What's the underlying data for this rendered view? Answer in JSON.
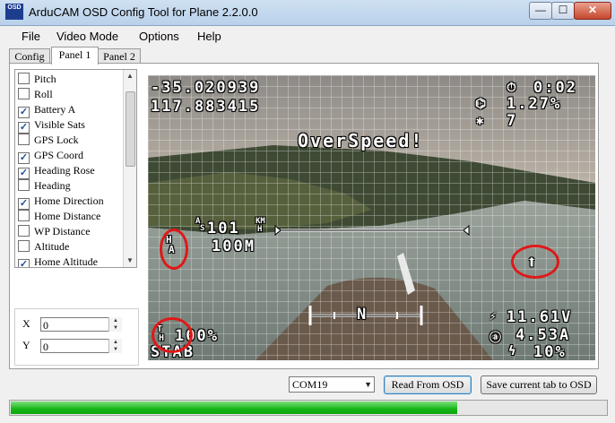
{
  "window": {
    "title": "ArduCAM OSD Config Tool for Plane 2.2.0.0",
    "icon_text": "ArduCAM OSD",
    "controls": [
      "minimize-icon",
      "maximize-icon",
      "close-icon"
    ]
  },
  "menu": [
    "File",
    "Video Mode",
    "Options",
    "Help"
  ],
  "tabs": [
    {
      "label": "Config",
      "active": false
    },
    {
      "label": "Panel 1",
      "active": true
    },
    {
      "label": "Panel 2",
      "active": false
    }
  ],
  "panel_items": [
    {
      "label": "Pitch",
      "checked": false
    },
    {
      "label": "Roll",
      "checked": false
    },
    {
      "label": "Battery A",
      "checked": true
    },
    {
      "label": "Visible Sats",
      "checked": true
    },
    {
      "label": "GPS Lock",
      "checked": false
    },
    {
      "label": "GPS Coord",
      "checked": true
    },
    {
      "label": "Heading Rose",
      "checked": true
    },
    {
      "label": "Heading",
      "checked": false
    },
    {
      "label": "Home Direction",
      "checked": true
    },
    {
      "label": "Home Distance",
      "checked": false
    },
    {
      "label": "WP Distance",
      "checked": false
    },
    {
      "label": "Altitude",
      "checked": false
    },
    {
      "label": "Home Altitude",
      "checked": true
    }
  ],
  "position": {
    "x_label": "X",
    "x_value": "0",
    "y_label": "Y",
    "y_value": "0"
  },
  "osd": {
    "lat": "-35.020939",
    "lon": "117.883415",
    "flight_time": "0:02",
    "throttle_pct": "1.27%",
    "sats": "7",
    "warning": "OverSpeed!",
    "airspeed": "101",
    "speed_unit_1": "KM",
    "speed_unit_2": "H",
    "home_alt": "100M",
    "throttle": "100%",
    "mode": "STAB",
    "heading_rose": "N",
    "voltage": "11.61V",
    "current": "4.53A",
    "battery_pct": "10%",
    "ha_label_top": "H",
    "ha_label_bottom": "A",
    "as_label_top": "A",
    "as_label_bottom": "S",
    "th_label_top": "T",
    "th_label_bottom": "H"
  },
  "bottom": {
    "com_port": "COM19",
    "read_button": "Read From OSD",
    "save_button": "Save current tab to OSD",
    "progress": 0.75
  },
  "colors": {
    "highlight_circle": "#e01818",
    "progress": "#16b516",
    "checkbox_mark": "#1c4e9c"
  }
}
